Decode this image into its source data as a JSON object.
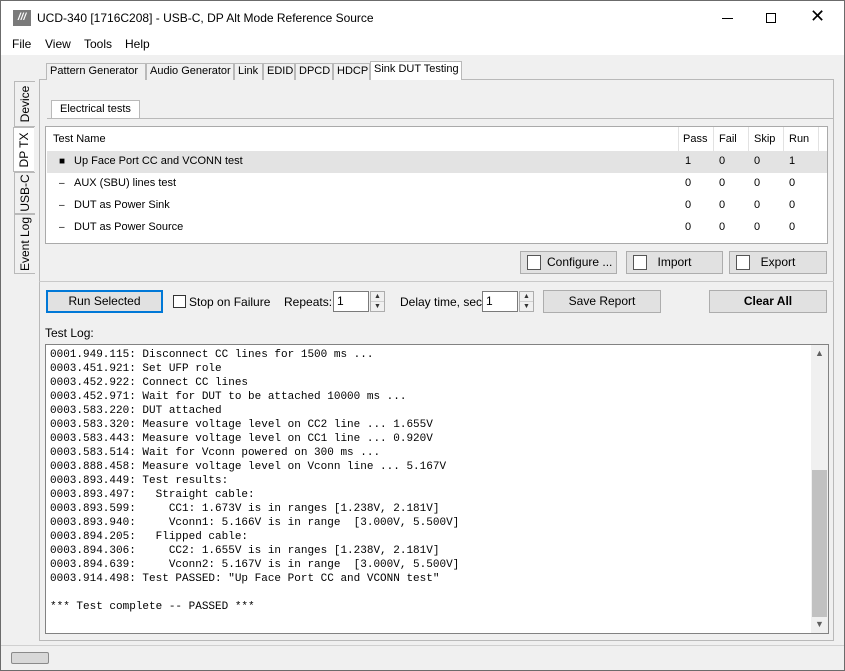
{
  "window": {
    "title": "UCD-340 [1716C208] - USB-C, DP Alt Mode Reference Source",
    "icon_text": "///",
    "minimize_glyph": "",
    "close_glyph": "✕"
  },
  "menu": [
    "File",
    "View",
    "Tools",
    "Help"
  ],
  "side_tabs": [
    "Device",
    "DP TX",
    "USB-C",
    "Event Log"
  ],
  "side_tab_active": "DP TX",
  "tabs": [
    "Pattern Generator",
    "Audio Generator",
    "Link",
    "EDID",
    "DPCD",
    "HDCP",
    "Sink DUT Testing"
  ],
  "tab_active": "Sink DUT Testing",
  "sub_tab": "Electrical tests",
  "tests": {
    "headers": {
      "name": "Test Name",
      "pass": "Pass",
      "fail": "Fail",
      "skip": "Skip",
      "run": "Run"
    },
    "rows": [
      {
        "bullet": "■",
        "name": "Up Face Port CC and VCONN test",
        "pass": "1",
        "fail": "0",
        "skip": "0",
        "run": "1"
      },
      {
        "bullet": "–",
        "name": "AUX (SBU) lines test",
        "pass": "0",
        "fail": "0",
        "skip": "0",
        "run": "0"
      },
      {
        "bullet": "–",
        "name": "DUT as Power Sink",
        "pass": "0",
        "fail": "0",
        "skip": "0",
        "run": "0"
      },
      {
        "bullet": "–",
        "name": "DUT as Power Source",
        "pass": "0",
        "fail": "0",
        "skip": "0",
        "run": "0"
      }
    ]
  },
  "buttons": {
    "configure": "Configure ...",
    "import": "Import",
    "export": "Export",
    "run_selected": "Run Selected",
    "save_report": "Save Report",
    "clear_all": "Clear All"
  },
  "controls": {
    "stop_on_failure": "Stop on Failure",
    "repeats_label": "Repeats:",
    "repeats_value": "1",
    "delay_label": "Delay time, sec:",
    "delay_value": "1"
  },
  "log": {
    "label": "Test Log:",
    "text": "0001.949.115: Disconnect CC lines for 1500 ms ...\n0003.451.921: Set UFP role\n0003.452.922: Connect CC lines\n0003.452.971: Wait for DUT to be attached 10000 ms ...\n0003.583.220: DUT attached\n0003.583.320: Measure voltage level on CC2 line ... 1.655V\n0003.583.443: Measure voltage level on CC1 line ... 0.920V\n0003.583.514: Wait for Vconn powered on 300 ms ...\n0003.888.458: Measure voltage level on Vconn line ... 5.167V\n0003.893.449: Test results:\n0003.893.497:   Straight cable:\n0003.893.599:     CC1: 1.673V is in ranges [1.238V, 2.181V]\n0003.893.940:     Vconn1: 5.166V is in range  [3.000V, 5.500V]\n0003.894.205:   Flipped cable:\n0003.894.306:     CC2: 1.655V is in ranges [1.238V, 2.181V]\n0003.894.639:     Vconn2: 5.167V is in range  [3.000V, 5.500V]\n0003.914.498: Test PASSED: \"Up Face Port CC and VCONN test\"\n\n*** Test complete -- PASSED ***"
  }
}
